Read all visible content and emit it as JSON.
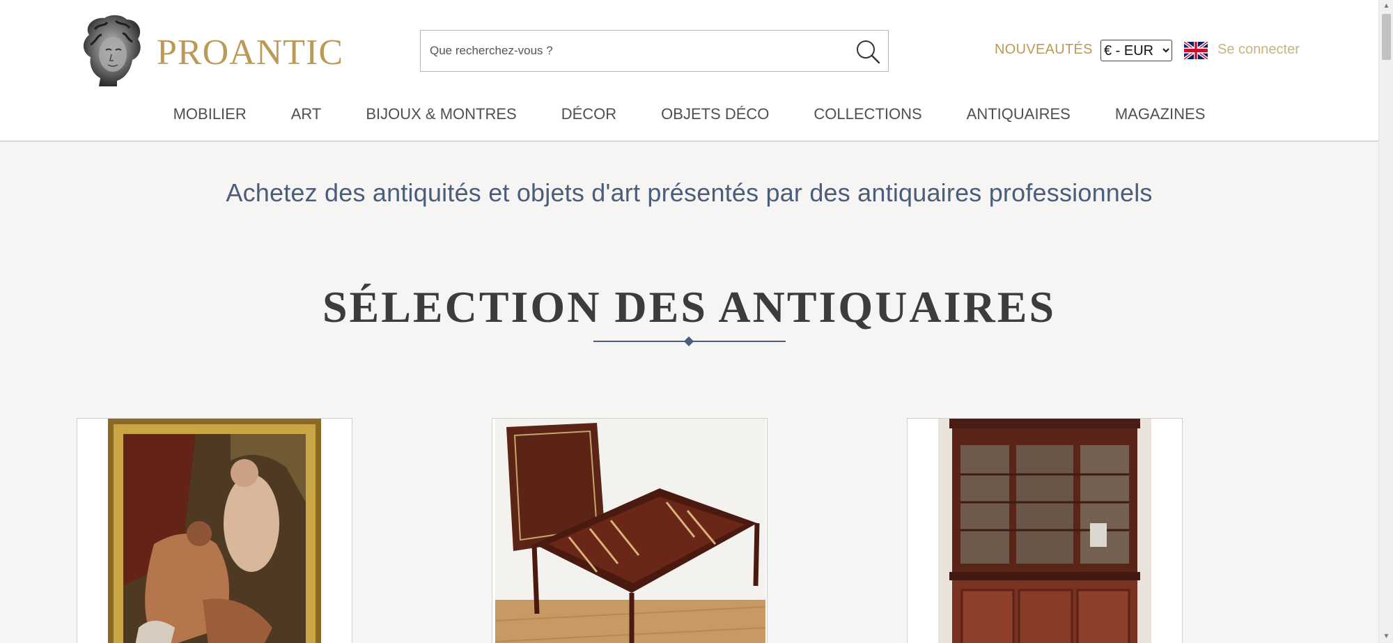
{
  "header": {
    "logo_text": "PROANTIC",
    "search_placeholder": "Que recherchez-vous ?",
    "new_label": "NOUVEAUTÉS",
    "currency": {
      "selected": "€ - EUR"
    },
    "login_label": "Se connecter"
  },
  "nav": {
    "items": [
      {
        "label": "MOBILIER"
      },
      {
        "label": "ART"
      },
      {
        "label": "BIJOUX & MONTRES"
      },
      {
        "label": "DÉCOR"
      },
      {
        "label": "OBJETS DÉCO"
      },
      {
        "label": "COLLECTIONS"
      },
      {
        "label": "ANTIQUAIRES"
      },
      {
        "label": "MAGAZINES"
      }
    ]
  },
  "main": {
    "tagline": "Achetez des antiquités et objets d'art présentés par des antiquaires professionnels",
    "section_title": "SÉLECTION DES ANTIQUAIRES",
    "products": [
      {
        "image": "framed-painting-image"
      },
      {
        "image": "backgammon-table-image"
      },
      {
        "image": "glazed-bookcase-image"
      }
    ]
  },
  "colors": {
    "brand_gold": "#bb9a57",
    "tagline_blue": "#4a5d79",
    "page_background": "#f6f5f3"
  },
  "icons": [
    "search-icon",
    "uk-flag-icon",
    "logo-bust-icon",
    "scroll-up-icon",
    "scroll-down-icon"
  ]
}
